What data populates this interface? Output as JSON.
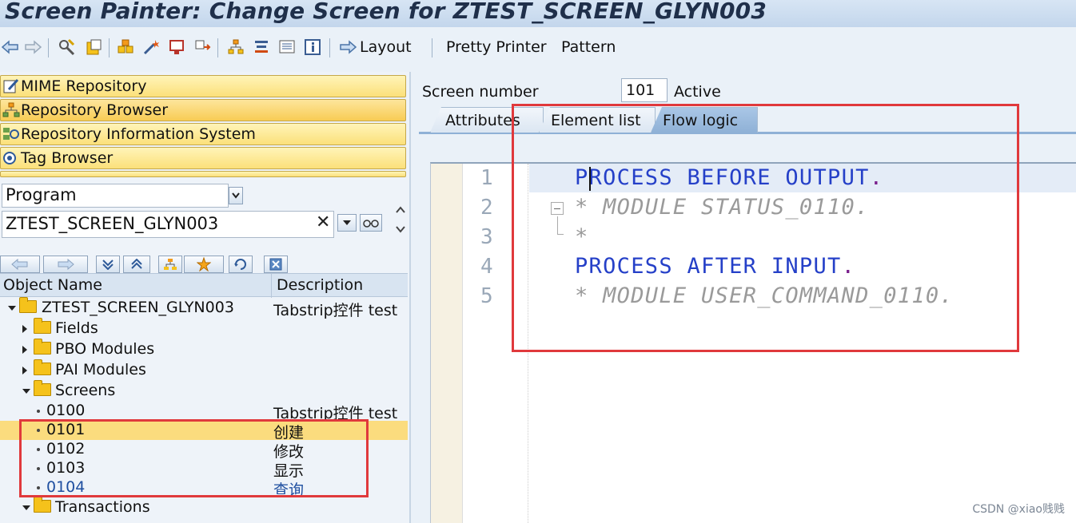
{
  "window": {
    "title": "Screen Painter: Change Screen for ZTEST_SCREEN_GLYN003"
  },
  "toolbar": {
    "layout_label": "Layout",
    "pretty_printer_label": "Pretty Printer",
    "pattern_label": "Pattern"
  },
  "nav": {
    "buttons": [
      {
        "label": "MIME Repository"
      },
      {
        "label": "Repository Browser"
      },
      {
        "label": "Repository Information System"
      },
      {
        "label": "Tag Browser"
      }
    ],
    "object_type_value": "Program",
    "object_name_value": "ZTEST_SCREEN_GLYN003"
  },
  "tree": {
    "col_object_name": "Object Name",
    "col_description": "Description",
    "root": {
      "name": "ZTEST_SCREEN_GLYN003",
      "desc": "Tabstrip控件 test"
    },
    "folders": {
      "fields": "Fields",
      "pbo": "PBO Modules",
      "pai": "PAI Modules",
      "screens": "Screens",
      "transactions": "Transactions"
    },
    "screens": [
      {
        "name": "0100",
        "desc": "Tabstrip控件 test"
      },
      {
        "name": "0101",
        "desc": "创建"
      },
      {
        "name": "0102",
        "desc": "修改"
      },
      {
        "name": "0103",
        "desc": "显示"
      },
      {
        "name": "0104",
        "desc": "查询"
      }
    ]
  },
  "editor": {
    "screen_number_label": "Screen number",
    "screen_number_value": "101",
    "status": "Active",
    "tabs": [
      {
        "label": "Attributes",
        "active": false
      },
      {
        "label": "Element list",
        "active": false
      },
      {
        "label": "Flow logic",
        "active": true
      }
    ],
    "lines": [
      {
        "num": "1",
        "kw1": "PROCESS",
        "kw2": "BEFORE",
        "kw3": "OUTPUT",
        "dot": "."
      },
      {
        "num": "2",
        "text": "* MODULE STATUS_0110."
      },
      {
        "num": "3",
        "text": "*"
      },
      {
        "num": "4",
        "kw1": "PROCESS",
        "kw2": "AFTER",
        "kw3": "INPUT",
        "dot": "."
      },
      {
        "num": "5",
        "text": "* MODULE USER_COMMAND_0110."
      }
    ]
  },
  "colors": {
    "nav_button": "#fbe07a",
    "selected_row": "#fbdc7e",
    "keyword": "#2540c8",
    "comment": "#9a9a9a",
    "highlight_box": "#e0393c"
  },
  "watermark": "CSDN @xiao贱贱"
}
